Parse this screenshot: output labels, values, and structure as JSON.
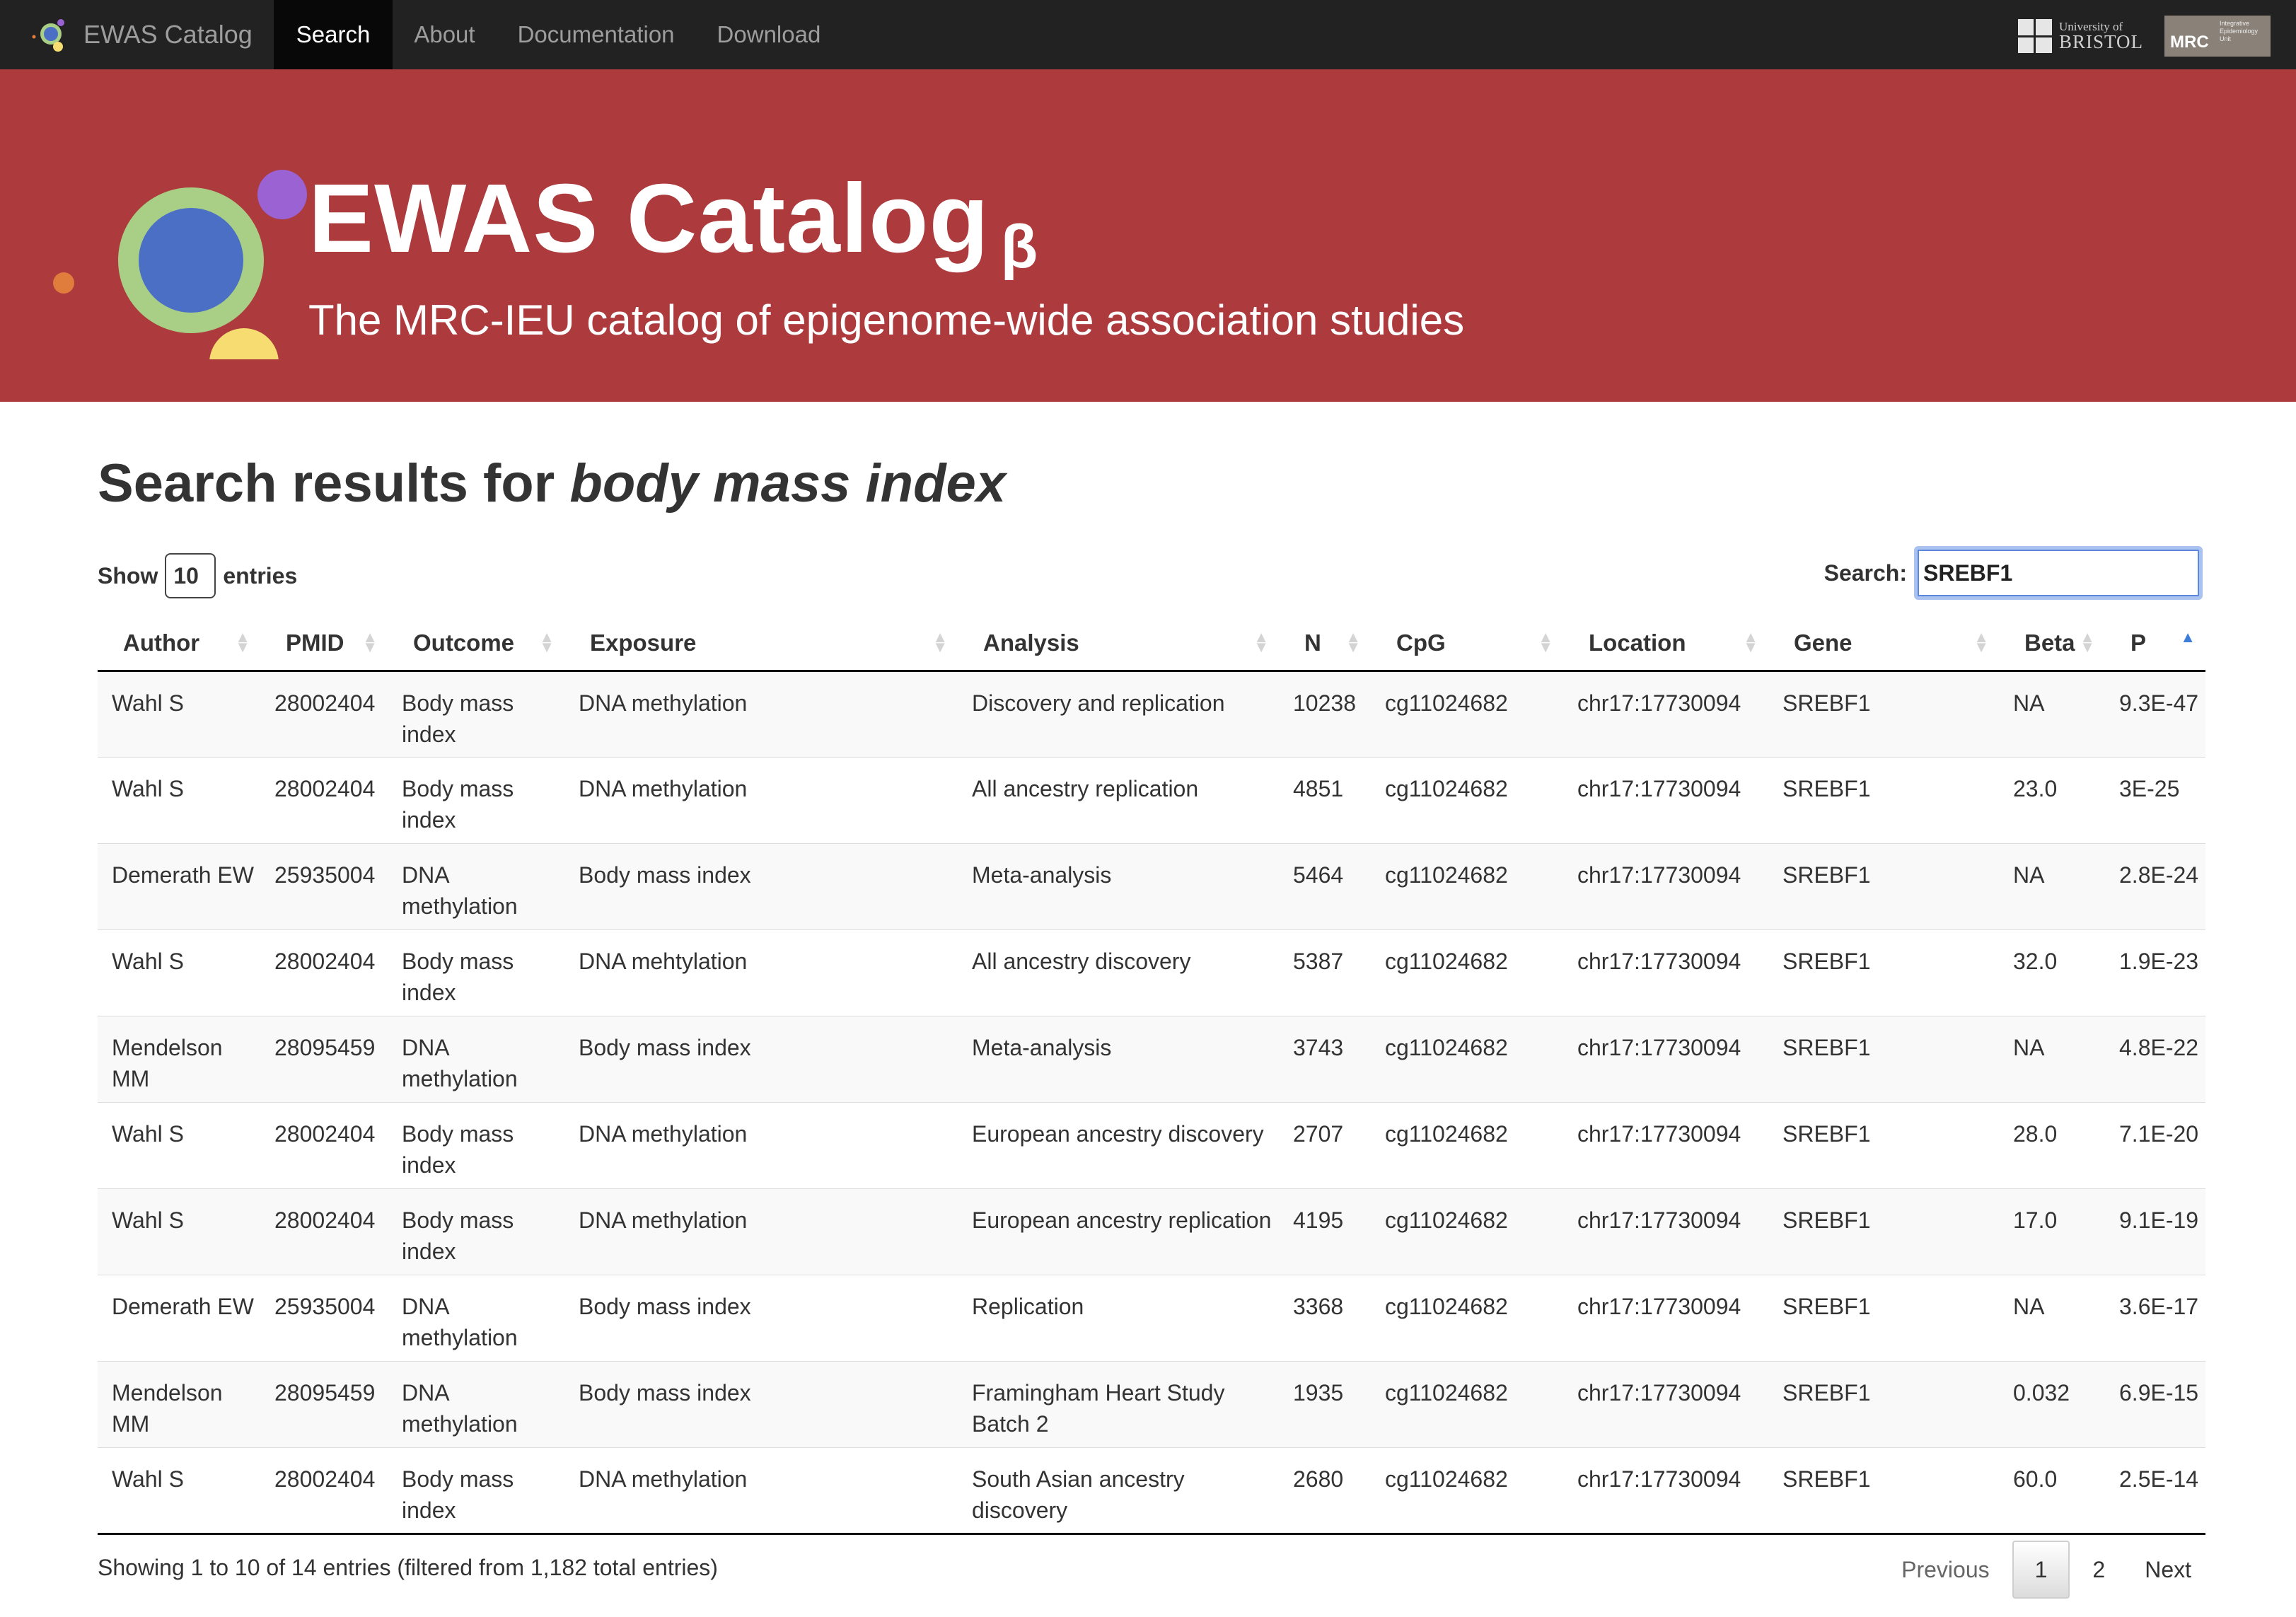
{
  "navbar": {
    "brand": "EWAS Catalog",
    "items": [
      "Search",
      "About",
      "Documentation",
      "Download"
    ],
    "active": "Search",
    "uob_line1": "University of",
    "uob_line2": "BRISTOL",
    "mrc_label": "MRC",
    "mrc_sub": "Integrative Epidemiology Unit"
  },
  "banner": {
    "title": "EWAS Catalog",
    "beta": "β",
    "subtitle": "The MRC-IEU catalog of epigenome-wide association studies"
  },
  "page": {
    "title_prefix": "Search results for",
    "query": "body mass index"
  },
  "controls": {
    "show_label": "Show",
    "page_length": "10",
    "entries_label": "entries",
    "search_label": "Search:",
    "search_value": "SREBF1"
  },
  "table": {
    "columns": [
      "Author",
      "PMID",
      "Outcome",
      "Exposure",
      "Analysis",
      "N",
      "CpG",
      "Location",
      "Gene",
      "Beta",
      "P"
    ],
    "rows": [
      [
        "Wahl S",
        "28002404",
        "Body mass index",
        "DNA methylation",
        "Discovery and replication",
        "10238",
        "cg11024682",
        "chr17:17730094",
        "SREBF1",
        "NA",
        "9.3E-47"
      ],
      [
        "Wahl S",
        "28002404",
        "Body mass index",
        "DNA methylation",
        "All ancestry replication",
        "4851",
        "cg11024682",
        "chr17:17730094",
        "SREBF1",
        "23.0",
        "3E-25"
      ],
      [
        "Demerath EW",
        "25935004",
        "DNA methylation",
        "Body mass index",
        "Meta-analysis",
        "5464",
        "cg11024682",
        "chr17:17730094",
        "SREBF1",
        "NA",
        "2.8E-24"
      ],
      [
        "Wahl S",
        "28002404",
        "Body mass index",
        "DNA mehtylation",
        "All ancestry discovery",
        "5387",
        "cg11024682",
        "chr17:17730094",
        "SREBF1",
        "32.0",
        "1.9E-23"
      ],
      [
        "Mendelson MM",
        "28095459",
        "DNA methylation",
        "Body mass index",
        "Meta-analysis",
        "3743",
        "cg11024682",
        "chr17:17730094",
        "SREBF1",
        "NA",
        "4.8E-22"
      ],
      [
        "Wahl S",
        "28002404",
        "Body mass index",
        "DNA methylation",
        "European ancestry discovery",
        "2707",
        "cg11024682",
        "chr17:17730094",
        "SREBF1",
        "28.0",
        "7.1E-20"
      ],
      [
        "Wahl S",
        "28002404",
        "Body mass index",
        "DNA methylation",
        "European ancestry replication",
        "4195",
        "cg11024682",
        "chr17:17730094",
        "SREBF1",
        "17.0",
        "9.1E-19"
      ],
      [
        "Demerath EW",
        "25935004",
        "DNA methylation",
        "Body mass index",
        "Replication",
        "3368",
        "cg11024682",
        "chr17:17730094",
        "SREBF1",
        "NA",
        "3.6E-17"
      ],
      [
        "Mendelson MM",
        "28095459",
        "DNA methylation",
        "Body mass index",
        "Framingham Heart Study Batch 2",
        "1935",
        "cg11024682",
        "chr17:17730094",
        "SREBF1",
        "0.032",
        "6.9E-15"
      ],
      [
        "Wahl S",
        "28002404",
        "Body mass index",
        "DNA methylation",
        "South Asian ancestry discovery",
        "2680",
        "cg11024682",
        "chr17:17730094",
        "SREBF1",
        "60.0",
        "2.5E-14"
      ]
    ]
  },
  "footer": {
    "info": "Showing 1 to 10 of 14 entries (filtered from 1,182 total entries)",
    "previous": "Previous",
    "pages": [
      "1",
      "2"
    ],
    "current_page": "1",
    "next": "Next"
  },
  "colors": {
    "navbar_bg": "#222222",
    "banner_bg": "#ad3a3d",
    "logo_blue": "#4a6fc4",
    "logo_green_ring": "#a9cf86",
    "logo_purple": "#9a62d2",
    "logo_yellow": "#f7dc72",
    "logo_orange": "#e07c3c"
  },
  "icons": {
    "brand_logo": "ewas-logo-icon",
    "sort": "sort-both-icon",
    "sort_active": "sort-asc-icon"
  }
}
